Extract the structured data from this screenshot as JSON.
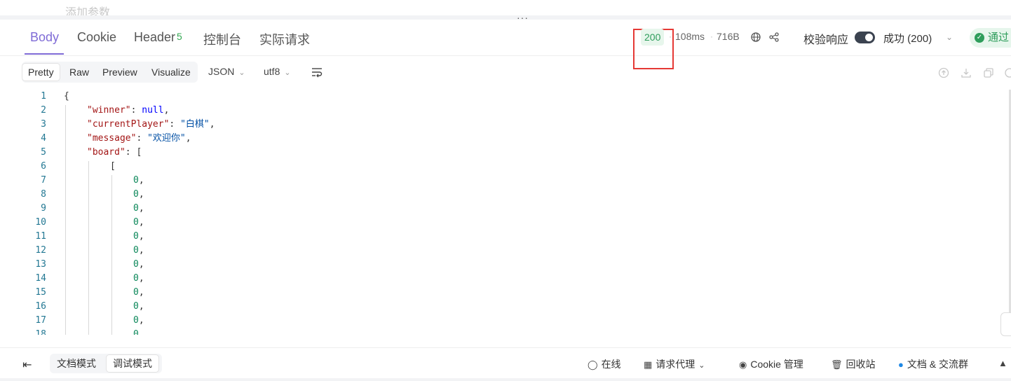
{
  "top": {
    "add_param": "添加参数",
    "drag_handle": "···"
  },
  "tabs": [
    {
      "label": "Body"
    },
    {
      "label": "Cookie"
    },
    {
      "label": "Header",
      "badge": "5"
    },
    {
      "label": "控制台"
    },
    {
      "label": "实际请求"
    }
  ],
  "status": {
    "code": "200",
    "time": "108ms",
    "size": "716B",
    "sep": "·"
  },
  "verify": {
    "label": "校验响应",
    "result": "成功 (200)",
    "pass": "通过"
  },
  "view_modes": [
    "Pretty",
    "Raw",
    "Preview",
    "Visualize"
  ],
  "format_dropdown": "JSON",
  "encoding_dropdown": "utf8",
  "code_lines": [
    {
      "n": "1"
    },
    {
      "n": "2"
    },
    {
      "n": "3"
    },
    {
      "n": "4"
    },
    {
      "n": "5"
    },
    {
      "n": "6"
    },
    {
      "n": "7"
    },
    {
      "n": "8"
    },
    {
      "n": "9"
    },
    {
      "n": "10"
    },
    {
      "n": "11"
    },
    {
      "n": "12"
    },
    {
      "n": "13"
    },
    {
      "n": "14"
    },
    {
      "n": "15"
    },
    {
      "n": "16"
    },
    {
      "n": "17"
    },
    {
      "n": "18"
    }
  ],
  "json": {
    "open": "{",
    "winner_key": "\"winner\"",
    "winner_val": "null",
    "player_key": "\"currentPlayer\"",
    "player_val": "\"白棋\"",
    "message_key": "\"message\"",
    "message_val": "\"欢迎你\"",
    "board_key": "\"board\"",
    "board_open": "[",
    "row_open": "[",
    "zero": "0"
  },
  "footer": {
    "doc_mode": "文档模式",
    "debug_mode": "调试模式",
    "online": "在线",
    "proxy": "请求代理",
    "cookie": "Cookie 管理",
    "trash": "回收站",
    "docs": "文档 & 交流群"
  }
}
